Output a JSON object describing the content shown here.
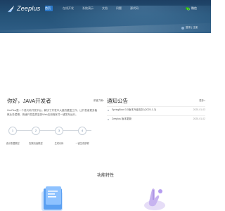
{
  "header": {
    "logo_text": "Zeeplus",
    "nav": [
      "首页",
      "在线开发",
      "系统演示",
      "文档",
      "问题",
      "源代码"
    ],
    "wechat_label": "微信",
    "user_label": "登录 | 注册"
  },
  "left_card": {
    "title": "你好，JAVA开发者",
    "more": "详细了解>",
    "description": "ZeePlus是一个低代码开发平台，解决了开发中大量的重复工作，让开发者更多聚焦业务逻辑，快速开发高质量的Web应用程序并一键发布运行。",
    "steps": [
      {
        "num": "1",
        "label": "设计数据模型"
      },
      {
        "num": "2",
        "label": "配置页面模型"
      },
      {
        "num": "3",
        "label": "生成代码"
      },
      {
        "num": "4",
        "label": "一键生成部署"
      }
    ]
  },
  "right_card": {
    "title": "通知公告",
    "more": "更多>",
    "notices": [
      {
        "text": "SpringBoot 3.0版本升级支持 (2025-1-3)",
        "date": "2025-01-03"
      },
      {
        "text": "Zeeplus 版本更新",
        "date": "2025-01-02"
      }
    ]
  },
  "features": {
    "title": "功能特性"
  },
  "colors": {
    "header_bg": "#245277",
    "nav_active": "#2b78c9",
    "wechat": "#2dc100"
  }
}
